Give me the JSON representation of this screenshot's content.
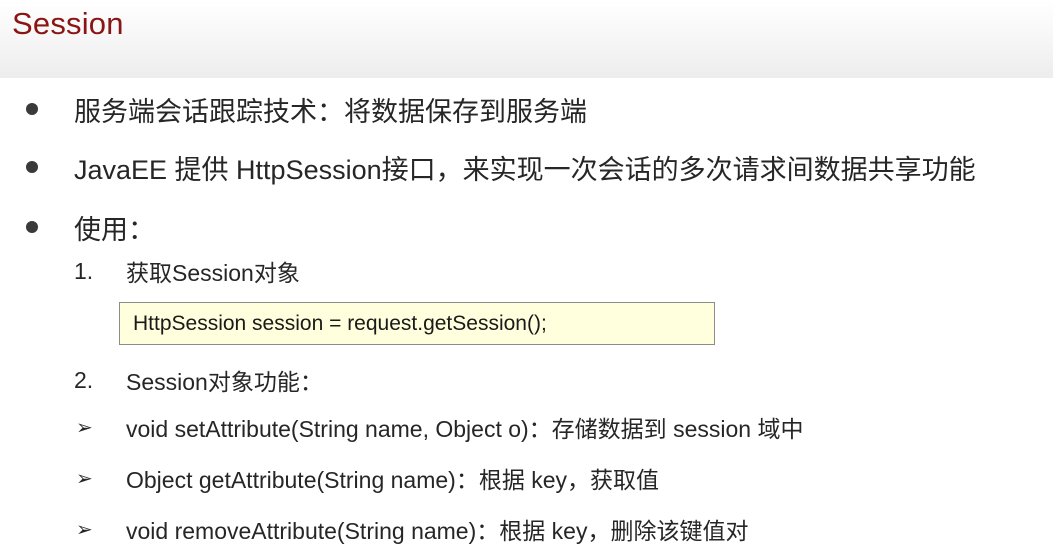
{
  "slide": {
    "title": "Session"
  },
  "bullets": [
    {
      "text": "服务端会话跟踪技术：将数据保存到服务端"
    },
    {
      "text": "JavaEE 提供 HttpSession接口，来实现一次会话的多次请求间数据共享功能"
    },
    {
      "text": "使用："
    }
  ],
  "steps": [
    {
      "number": "1.",
      "text": "获取Session对象"
    },
    {
      "number": "2.",
      "text": "Session对象功能："
    }
  ],
  "code": {
    "line": "HttpSession session = request.getSession();"
  },
  "methods": [
    {
      "marker": "➢",
      "text": "void setAttribute(String name, Object o)：存储数据到 session 域中"
    },
    {
      "marker": "➢",
      "text": "Object getAttribute(String name)：根据 key，获取值"
    },
    {
      "marker": "➢",
      "text": " void removeAttribute(String name)：根据 key，删除该键值对"
    }
  ],
  "colors": {
    "title": "#8b1515",
    "code_background": "#ffffdd",
    "text": "#262626"
  }
}
